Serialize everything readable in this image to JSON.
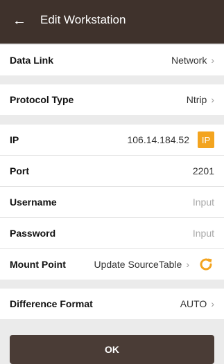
{
  "header": {
    "title": "Edit Workstation",
    "back_icon": "arrow-left-icon"
  },
  "rows": {
    "data_link": {
      "label": "Data Link",
      "value": "Network"
    },
    "protocol_type": {
      "label": "Protocol Type",
      "value": "Ntrip"
    },
    "ip": {
      "label": "IP",
      "value": "106.14.184.52",
      "badge": "IP"
    },
    "port": {
      "label": "Port",
      "value": "2201"
    },
    "username": {
      "label": "Username",
      "placeholder": "Input"
    },
    "password": {
      "label": "Password",
      "placeholder": "Input"
    },
    "mount_point": {
      "label": "Mount Point",
      "value": "Update SourceTable",
      "icon": "refresh-icon"
    },
    "difference_format": {
      "label": "Difference Format",
      "value": "AUTO"
    }
  },
  "ok_button": {
    "label": "OK"
  },
  "colors": {
    "header_bg": "#3f322c",
    "accent": "#f3a41f",
    "button_bg": "#4a3c36"
  }
}
